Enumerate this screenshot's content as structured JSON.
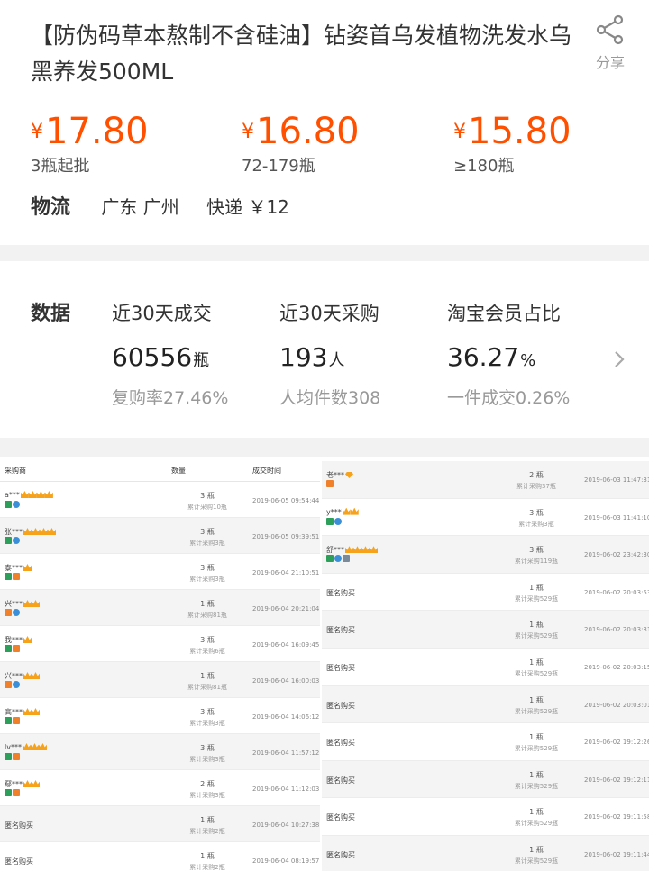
{
  "product": {
    "title": "【防伪码草本熬制不含硅油】钻姿首乌发植物洗发水乌黑养发500ML",
    "share_label": "分享",
    "price_tiers": [
      {
        "currency": "¥",
        "price": "17.80",
        "condition": "3瓶起批"
      },
      {
        "currency": "¥",
        "price": "16.80",
        "condition": "72-179瓶"
      },
      {
        "currency": "¥",
        "price": "15.80",
        "condition": "≥180瓶"
      }
    ],
    "logistics": {
      "label": "物流",
      "region": "广东 广州",
      "method": "快递 ￥12"
    }
  },
  "stats": {
    "label": "数据",
    "items": [
      {
        "title": "近30天成交",
        "value": "60556",
        "unit": "瓶",
        "sub": "复购率27.46%"
      },
      {
        "title": "近30天采购",
        "value": "193",
        "unit": "人",
        "sub": "人均件数308"
      },
      {
        "title": "淘宝会员占比",
        "value": "36.27",
        "unit": "%",
        "sub": "一件成交0.26%"
      }
    ]
  },
  "records": {
    "headers": {
      "buyer": "采购商",
      "qty": "数量",
      "time": "成交时间"
    },
    "left": [
      {
        "buyer": "a***",
        "crowns": 4,
        "icons": [
          "green",
          "blue"
        ],
        "qty": "3 瓶",
        "acc": "累计采购10瓶",
        "time": "2019-06-05 09:54:44"
      },
      {
        "buyer": "张***",
        "crowns": 4,
        "icons": [
          "green",
          "blue"
        ],
        "qty": "3 瓶",
        "acc": "累计采购3瓶",
        "time": "2019-06-05 09:39:51"
      },
      {
        "buyer": "泰***",
        "crowns": 1,
        "icons": [
          "green",
          "orange"
        ],
        "qty": "3 瓶",
        "acc": "累计采购3瓶",
        "time": "2019-06-04 21:10:51"
      },
      {
        "buyer": "兴***",
        "crowns": 2,
        "icons": [
          "orange",
          "blue"
        ],
        "qty": "1 瓶",
        "acc": "累计采购81瓶",
        "time": "2019-06-04 20:21:04"
      },
      {
        "buyer": "我***",
        "crowns": 1,
        "icons": [
          "green",
          "orange"
        ],
        "qty": "3 瓶",
        "acc": "累计采购6瓶",
        "time": "2019-06-04 16:09:45"
      },
      {
        "buyer": "兴***",
        "crowns": 2,
        "icons": [
          "orange",
          "blue"
        ],
        "qty": "1 瓶",
        "acc": "累计采购81瓶",
        "time": "2019-06-04 16:00:03"
      },
      {
        "buyer": "高***",
        "crowns": 2,
        "icons": [
          "green",
          "orange"
        ],
        "qty": "3 瓶",
        "acc": "累计采购3瓶",
        "time": "2019-06-04 14:06:12"
      },
      {
        "buyer": "lv***",
        "crowns": 3,
        "icons": [
          "green",
          "orange"
        ],
        "qty": "3 瓶",
        "acc": "累计采购3瓶",
        "time": "2019-06-04 11:57:12"
      },
      {
        "buyer": "鄢***",
        "crowns": 2,
        "icons": [
          "green",
          "orange"
        ],
        "qty": "2 瓶",
        "acc": "累计采购3瓶",
        "time": "2019-06-04 11:12:03"
      },
      {
        "buyer": "匿名购买",
        "anon": true,
        "crowns": 0,
        "icons": [],
        "qty": "1 瓶",
        "acc": "累计采购2瓶",
        "time": "2019-06-04 10:27:38"
      },
      {
        "buyer": "匿名购买",
        "anon": true,
        "crowns": 0,
        "icons": [],
        "qty": "1 瓶",
        "acc": "累计采购2瓶",
        "time": "2019-06-04 08:19:57"
      }
    ],
    "right": [
      {
        "buyer": "老***",
        "diamond": true,
        "crowns": 0,
        "icons": [
          "orange"
        ],
        "qty": "2 瓶",
        "acc": "累计采购37瓶",
        "time": "2019-06-03 11:47:31"
      },
      {
        "buyer": "y***",
        "crowns": 2,
        "icons": [
          "green",
          "blue"
        ],
        "qty": "3 瓶",
        "acc": "累计采购3瓶",
        "time": "2019-06-03 11:41:10"
      },
      {
        "buyer": "舒***",
        "crowns": 4,
        "icons": [
          "green",
          "blue",
          "gray"
        ],
        "qty": "3 瓶",
        "acc": "累计采购119瓶",
        "time": "2019-06-02 23:42:30"
      },
      {
        "buyer": "匿名购买",
        "anon": true,
        "crowns": 0,
        "icons": [],
        "qty": "1 瓶",
        "acc": "累计采购529瓶",
        "time": "2019-06-02 20:03:53"
      },
      {
        "buyer": "匿名购买",
        "anon": true,
        "crowns": 0,
        "icons": [],
        "qty": "1 瓶",
        "acc": "累计采购529瓶",
        "time": "2019-06-02 20:03:31"
      },
      {
        "buyer": "匿名购买",
        "anon": true,
        "crowns": 0,
        "icons": [],
        "qty": "1 瓶",
        "acc": "累计采购529瓶",
        "time": "2019-06-02 20:03:15"
      },
      {
        "buyer": "匿名购买",
        "anon": true,
        "crowns": 0,
        "icons": [],
        "qty": "1 瓶",
        "acc": "累计采购529瓶",
        "time": "2019-06-02 20:03:01"
      },
      {
        "buyer": "匿名购买",
        "anon": true,
        "crowns": 0,
        "icons": [],
        "qty": "1 瓶",
        "acc": "累计采购529瓶",
        "time": "2019-06-02 19:12:26"
      },
      {
        "buyer": "匿名购买",
        "anon": true,
        "crowns": 0,
        "icons": [],
        "qty": "1 瓶",
        "acc": "累计采购529瓶",
        "time": "2019-06-02 19:12:11"
      },
      {
        "buyer": "匿名购买",
        "anon": true,
        "crowns": 0,
        "icons": [],
        "qty": "1 瓶",
        "acc": "累计采购529瓶",
        "time": "2019-06-02 19:11:58"
      },
      {
        "buyer": "匿名购买",
        "anon": true,
        "crowns": 0,
        "icons": [],
        "qty": "1 瓶",
        "acc": "累计采购529瓶",
        "time": "2019-06-02 19:11:44"
      }
    ]
  },
  "colors": {
    "price": "#ff5000",
    "muted": "#999999",
    "badge": "#f6a21a"
  }
}
